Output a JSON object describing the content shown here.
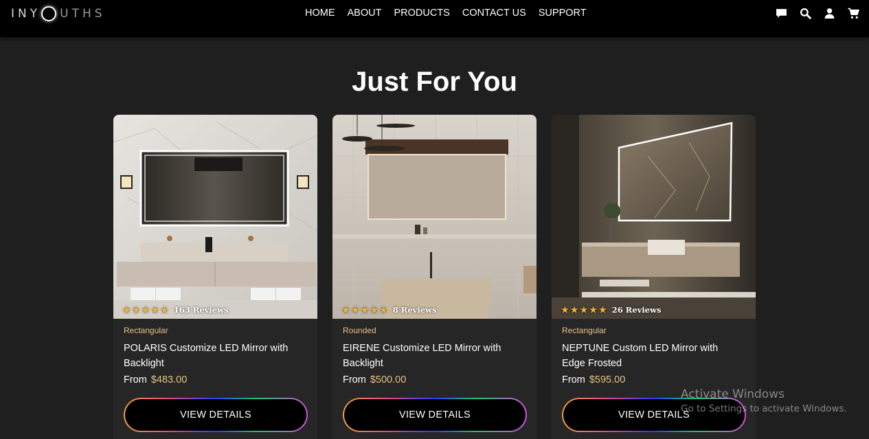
{
  "header": {
    "logo": {
      "part1": "INY",
      "part2": "UTHS"
    },
    "nav": [
      "HOME",
      "ABOUT",
      "PRODUCTS",
      "CONTACT US",
      "SUPPORT"
    ],
    "icons": [
      "chat-icon",
      "search-icon",
      "user-icon",
      "cart-icon"
    ]
  },
  "section": {
    "title": "Just For You"
  },
  "products": [
    {
      "rating_stars": 5,
      "reviews": "163 Reviews",
      "category": "Rectangular",
      "name": "POLARIS Customize LED Mirror with Backlight",
      "price_label": "From",
      "price": "$483.00",
      "button": "VIEW DETAILS"
    },
    {
      "rating_stars": 5,
      "reviews": "8 Reviews",
      "category": "Rounded",
      "name": "EIRENE Customize LED Mirror with Backlight",
      "price_label": "From",
      "price": "$500.00",
      "button": "VIEW DETAILS"
    },
    {
      "rating_stars": 5,
      "reviews": "26 Reviews",
      "category": "Rectangular",
      "name": "NEPTUNE Custom LED Mirror with Edge Frosted",
      "price_label": "From",
      "price": "$595.00",
      "button": "VIEW DETAILS"
    }
  ],
  "watermark": {
    "line1": "Activate Windows",
    "line2": "Go to Settings to activate Windows."
  },
  "colors": {
    "accent": "#e6c288",
    "star": "#f2b632",
    "background": "#1f1f1f",
    "card": "#262626",
    "header": "#000000"
  }
}
